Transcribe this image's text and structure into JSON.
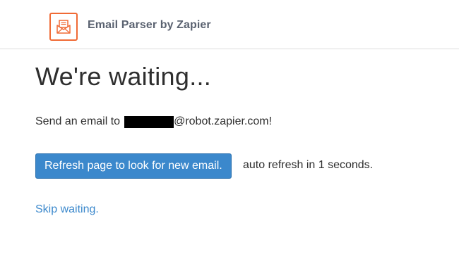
{
  "header": {
    "brand": "Email Parser by Zapier",
    "logo_icon": "envelope-icon",
    "accent_color": "#f06a35"
  },
  "main": {
    "title": "We're waiting...",
    "send_prefix": "Send an email to",
    "send_suffix": "@robot.zapier.com!",
    "refresh_button_label": "Refresh page to look for new email.",
    "auto_refresh_text": "auto refresh in 1 seconds.",
    "skip_link_label": "Skip waiting."
  },
  "colors": {
    "button": "#3b88cc",
    "link": "#3b88cc",
    "text": "#2e2e2e"
  }
}
